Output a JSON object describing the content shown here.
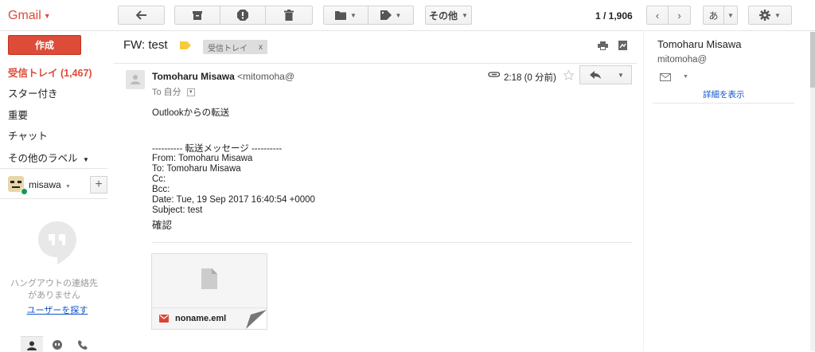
{
  "app": {
    "name": "Gmail"
  },
  "toolbar": {
    "more_label": "その他",
    "pager_current": "1 / 1,906",
    "lang_label": "あ"
  },
  "sidebar": {
    "compose_label": "作成",
    "items": [
      {
        "label": "受信トレイ (1,467)",
        "active": true
      },
      {
        "label": "スター付き"
      },
      {
        "label": "重要"
      },
      {
        "label": "チャット"
      },
      {
        "label": "その他のラベル"
      }
    ],
    "account_name": "misawa",
    "hangouts_empty": "ハングアウトの連絡先がありません",
    "find_people_link": "ユーザーを探す"
  },
  "message": {
    "subject": "FW: test",
    "chip_label": "受信トレイ",
    "chip_close": "x",
    "sender_name": "Tomoharu Misawa",
    "sender_email": "<mitomoha@",
    "to_label": "To 自分",
    "time": "2:18 (0 分前)",
    "body_intro": "Outlookからの転送",
    "forward_header": "---------- 転送メッセージ ----------",
    "from_line": "From: Tomoharu Misawa",
    "to_line": "To: Tomoharu Misawa",
    "cc_line": "Cc:",
    "bcc_line": "Bcc:",
    "date_line": "Date: Tue, 19 Sep 2017 16:40:54 +0000",
    "subject_line": "Subject: test",
    "body_text": "確認",
    "attachment_name": "noname.eml"
  },
  "contact_panel": {
    "name": "Tomoharu Misawa",
    "email": "mitomoha@",
    "details_link": "詳細を表示"
  },
  "colors": {
    "brand_red": "#dd4b39",
    "link_blue": "#1155cc",
    "label_yellow": "#f6cc3d",
    "online_green": "#0f9d58"
  }
}
